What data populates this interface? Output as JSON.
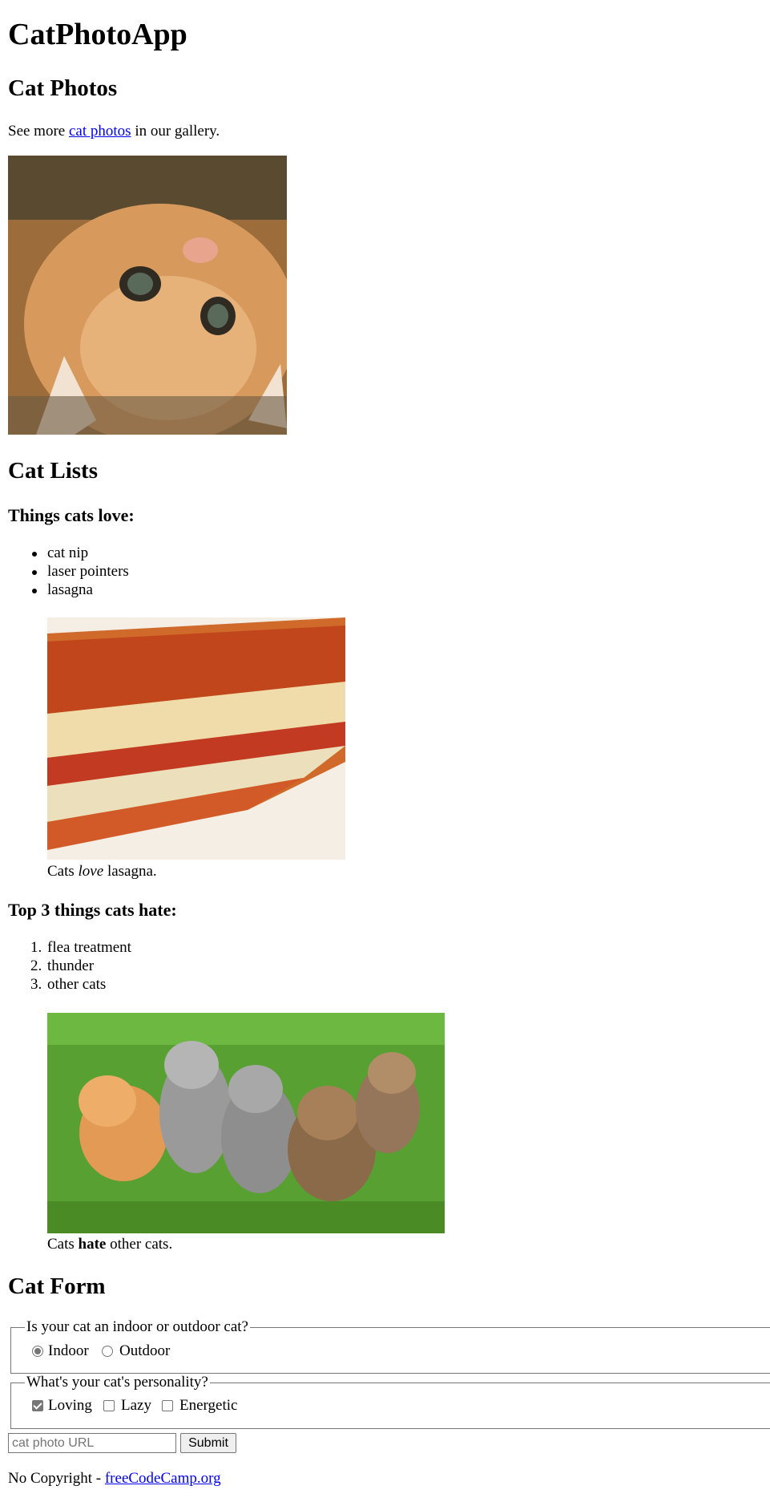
{
  "header": {
    "title": "CatPhotoApp"
  },
  "photos": {
    "heading": "Cat Photos",
    "intro_before": "See more ",
    "intro_link": "cat photos",
    "intro_after": " in our gallery."
  },
  "lists": {
    "heading": "Cat Lists",
    "love_heading": "Things cats love:",
    "love_items": [
      "cat nip",
      "laser pointers",
      "lasagna"
    ],
    "love_caption_before": "Cats ",
    "love_caption_emph": "love",
    "love_caption_after": " lasagna.",
    "hate_heading": "Top 3 things cats hate:",
    "hate_items": [
      "flea treatment",
      "thunder",
      "other cats"
    ],
    "hate_numbers": [
      "1.",
      "2.",
      "3."
    ],
    "hate_caption_before": "Cats ",
    "hate_caption_strong": "hate",
    "hate_caption_after": " other cats."
  },
  "form": {
    "heading": "Cat Form",
    "location_legend": "Is your cat an indoor or outdoor cat?",
    "location_options": [
      {
        "label": "Indoor",
        "checked": true
      },
      {
        "label": "Outdoor",
        "checked": false
      }
    ],
    "personality_legend": "What's your cat's personality?",
    "personality_options": [
      {
        "label": "Loving",
        "checked": true
      },
      {
        "label": "Lazy",
        "checked": false
      },
      {
        "label": "Energetic",
        "checked": false
      }
    ],
    "url_placeholder": "cat photo URL",
    "submit_label": "Submit"
  },
  "footer": {
    "text": "No Copyright - ",
    "link": "freeCodeCamp.org"
  }
}
